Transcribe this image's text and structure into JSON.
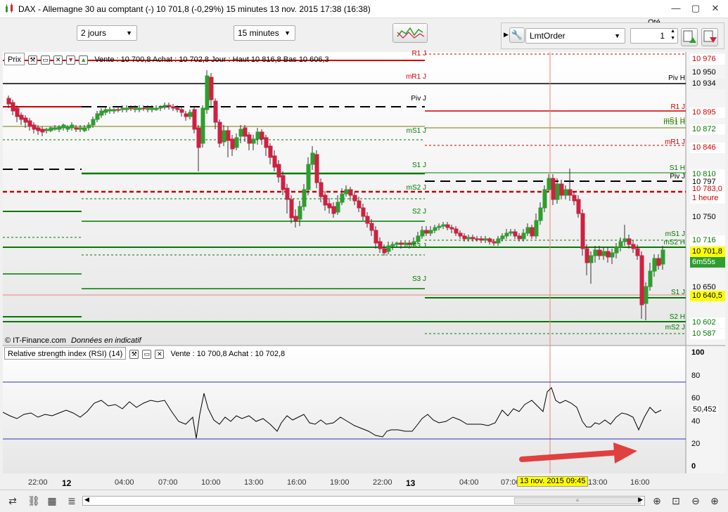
{
  "window": {
    "title": "DAX - Allemagne 30 au comptant (-)   10 701,8 (-0,29%)   15 minutes  13 nov. 2015 17:38 (16:38)",
    "controls": [
      "—",
      "▢",
      "✕"
    ]
  },
  "toolbar": {
    "period_select": "2 jours",
    "interval_select": "15 minutes",
    "qty_label": "Qté",
    "order_type": "LmtOrder",
    "qty_value": "1"
  },
  "price_panel": {
    "label": "Prix",
    "info": "Vente : 10 700,8 Achat : 10 702,8 Jour : Haut 10 816,8 Bas 10 606,3",
    "copyright": "© IT-Finance.com",
    "disclaimer": "Données en indicatif",
    "pivot_labels": {
      "left": [
        "R1 J",
        "mR1 J",
        "Piv J",
        "mS1 J",
        "S1 J",
        "mS2 J",
        "S2 J",
        "mS3 J",
        "S3 J"
      ],
      "right": [
        "Piv H",
        "R1 J",
        "mS1 H",
        "mS1 H",
        "mR1 J",
        "S1 H",
        "Piv J",
        "mS1 J",
        "mS2 H",
        "S1 J",
        "S2 H",
        "mS2 J"
      ]
    },
    "price_axis": [
      "10 976",
      "10 950",
      "10 934",
      "10 895",
      "10 872",
      "10 846",
      "10 810",
      "10 797",
      "10 783,0",
      "1 heure",
      "10 750",
      "10 716",
      "10 701,8",
      "6m55s",
      "10 650",
      "10 640,5",
      "10 602",
      "10 587"
    ]
  },
  "rsi_panel": {
    "label": "Relative strength index (RSI) (14)",
    "info": "Vente : 10 700,8 Achat : 10 702,8",
    "axis": [
      "100",
      "80",
      "60",
      "50,452",
      "40",
      "20",
      "0"
    ]
  },
  "time_axis": {
    "ticks": [
      "22:00",
      "12",
      "04:00",
      "07:00",
      "10:00",
      "13:00",
      "16:00",
      "19:00",
      "22:00",
      "13",
      "04:00",
      "07:00",
      "13:00",
      "16:00"
    ],
    "cursor_date": "13 nov. 2015 09:45"
  },
  "colors": {
    "bull": "#2e9e2e",
    "bear": "#d02040",
    "resistance": "#d00000",
    "support": "#007a00",
    "pivot": "#000000",
    "current_price_box": "#ffff00",
    "rsi_line": "#000000",
    "rsi_band": "#3030c0",
    "arrow": "#e04040"
  }
}
